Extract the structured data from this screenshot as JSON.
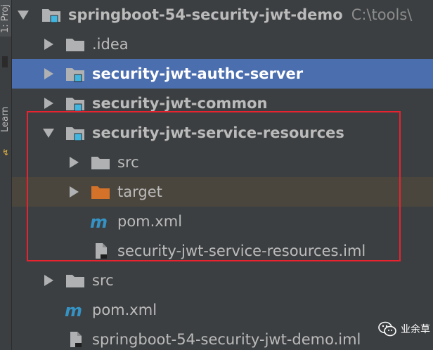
{
  "tool_strip": {
    "project_tab": "1: Proj",
    "learn_tab": "Learn",
    "learn_icon": "lightning-icon"
  },
  "tree": {
    "root": {
      "label": "springboot-54-security-jwt-demo",
      "path": "C:\\tools\\",
      "icon": "module-folder-icon",
      "expanded": true
    },
    "items": [
      {
        "label": ".idea",
        "icon": "folder-icon",
        "expanded": false
      },
      {
        "label": "security-jwt-authc-server",
        "icon": "module-folder-icon",
        "expanded": false,
        "selected": true
      },
      {
        "label": "security-jwt-common",
        "icon": "module-folder-icon",
        "expanded": false
      },
      {
        "label": "security-jwt-service-resources",
        "icon": "module-folder-icon",
        "expanded": true
      },
      {
        "label": "src",
        "icon": "folder-icon",
        "expanded": false
      },
      {
        "label": "target",
        "icon": "excluded-folder-icon",
        "expanded": false
      },
      {
        "label": "pom.xml",
        "icon": "maven-icon"
      },
      {
        "label": "security-jwt-service-resources.iml",
        "icon": "iml-file-icon"
      },
      {
        "label": "src",
        "icon": "folder-icon",
        "expanded": false
      },
      {
        "label": "pom.xml",
        "icon": "maven-icon"
      },
      {
        "label": "springboot-54-security-jwt-demo.iml",
        "icon": "iml-file-icon"
      }
    ]
  },
  "colors": {
    "background": "#3c3f41",
    "selected_row": "#4b6eaf",
    "hover_row": "#4a463d",
    "highlight_box": "#e8232f",
    "text": "#bbbbbb",
    "maven_blue": "#3592c4",
    "excluded_folder": "#d4722a"
  },
  "watermark": {
    "text": "业余草",
    "icon": "wechat-icon"
  }
}
